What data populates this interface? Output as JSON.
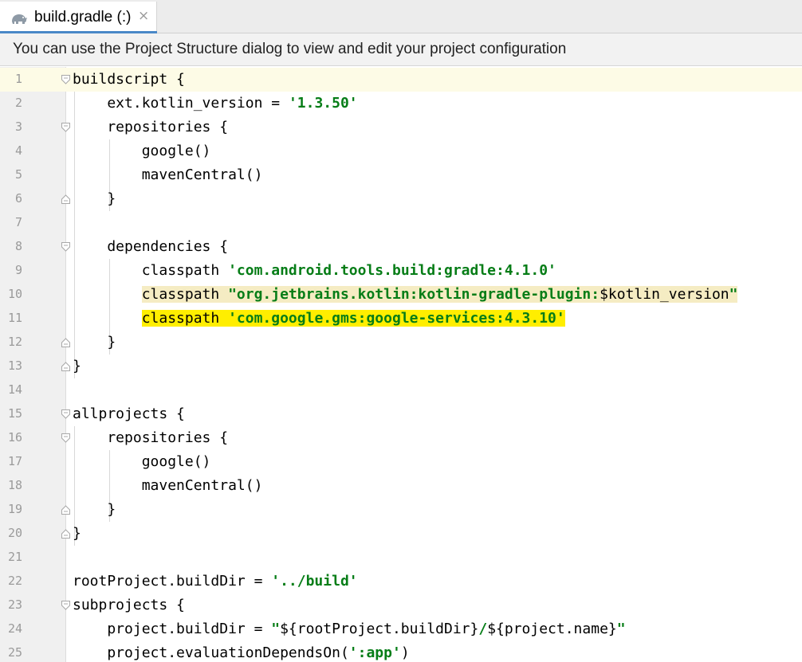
{
  "tab": {
    "label": "build.gradle (:)",
    "close_symbol": "×",
    "icon": "gradle-elephant-icon"
  },
  "banner": {
    "text": "You can use the Project Structure dialog to view and edit your project configuration"
  },
  "editor": {
    "lines": [
      {
        "n": "1",
        "fold": "open",
        "segments": [
          {
            "t": "buildscript {",
            "c": "kw"
          }
        ]
      },
      {
        "n": "2",
        "fold": "",
        "segments": [
          {
            "t": "    ext.kotlin_version = ",
            "c": "kw"
          },
          {
            "t": "'1.3.50'",
            "c": "str"
          }
        ]
      },
      {
        "n": "3",
        "fold": "open",
        "segments": [
          {
            "t": "    repositories {",
            "c": "kw"
          }
        ]
      },
      {
        "n": "4",
        "fold": "",
        "segments": [
          {
            "t": "        google()",
            "c": "kw"
          }
        ]
      },
      {
        "n": "5",
        "fold": "",
        "segments": [
          {
            "t": "        mavenCentral()",
            "c": "kw"
          }
        ]
      },
      {
        "n": "6",
        "fold": "close",
        "segments": [
          {
            "t": "    }",
            "c": "kw"
          }
        ]
      },
      {
        "n": "7",
        "fold": "",
        "segments": []
      },
      {
        "n": "8",
        "fold": "open",
        "segments": [
          {
            "t": "    dependencies {",
            "c": "kw"
          }
        ]
      },
      {
        "n": "9",
        "fold": "",
        "segments": [
          {
            "t": "        classpath ",
            "c": "kw"
          },
          {
            "t": "'com.android.tools.build:gradle:4.1.0'",
            "c": "str"
          }
        ]
      },
      {
        "n": "10",
        "fold": "",
        "hl": "light",
        "segments": [
          {
            "t": "        ",
            "c": "kw",
            "nohl": true
          },
          {
            "t": "classpath ",
            "c": "kw"
          },
          {
            "t": "\"org.jetbrains.kotlin:kotlin-gradle-plugin:",
            "c": "str-dq"
          },
          {
            "t": "$kotlin_version",
            "c": "var"
          },
          {
            "t": "\"",
            "c": "str-dq"
          }
        ]
      },
      {
        "n": "11",
        "fold": "",
        "hl": "strong",
        "segments": [
          {
            "t": "        ",
            "c": "kw",
            "nohl": true
          },
          {
            "t": "classpath ",
            "c": "kw"
          },
          {
            "t": "'com.google.gms:google-services:4.3.10'",
            "c": "str"
          }
        ]
      },
      {
        "n": "12",
        "fold": "close",
        "segments": [
          {
            "t": "    }",
            "c": "kw"
          }
        ]
      },
      {
        "n": "13",
        "fold": "close",
        "segments": [
          {
            "t": "}",
            "c": "kw"
          }
        ]
      },
      {
        "n": "14",
        "fold": "",
        "segments": []
      },
      {
        "n": "15",
        "fold": "open",
        "segments": [
          {
            "t": "allprojects {",
            "c": "kw"
          }
        ]
      },
      {
        "n": "16",
        "fold": "open",
        "segments": [
          {
            "t": "    repositories {",
            "c": "kw"
          }
        ]
      },
      {
        "n": "17",
        "fold": "",
        "segments": [
          {
            "t": "        google()",
            "c": "kw"
          }
        ]
      },
      {
        "n": "18",
        "fold": "",
        "segments": [
          {
            "t": "        mavenCentral()",
            "c": "kw"
          }
        ]
      },
      {
        "n": "19",
        "fold": "close",
        "segments": [
          {
            "t": "    }",
            "c": "kw"
          }
        ]
      },
      {
        "n": "20",
        "fold": "close",
        "segments": [
          {
            "t": "}",
            "c": "kw"
          }
        ]
      },
      {
        "n": "21",
        "fold": "",
        "segments": []
      },
      {
        "n": "22",
        "fold": "",
        "segments": [
          {
            "t": "rootProject.buildDir = ",
            "c": "kw"
          },
          {
            "t": "'../build'",
            "c": "str"
          }
        ]
      },
      {
        "n": "23",
        "fold": "open",
        "segments": [
          {
            "t": "subprojects {",
            "c": "kw"
          }
        ]
      },
      {
        "n": "24",
        "fold": "",
        "segments": [
          {
            "t": "    project.buildDir = ",
            "c": "kw"
          },
          {
            "t": "\"",
            "c": "str-dq"
          },
          {
            "t": "${rootProject.buildDir}",
            "c": "var"
          },
          {
            "t": "/",
            "c": "str-dq"
          },
          {
            "t": "${project.name}",
            "c": "var"
          },
          {
            "t": "\"",
            "c": "str-dq"
          }
        ]
      },
      {
        "n": "25",
        "fold": "",
        "segments": [
          {
            "t": "    project.evaluationDependsOn(",
            "c": "kw"
          },
          {
            "t": "':app'",
            "c": "str"
          },
          {
            "t": ")",
            "c": "kw"
          }
        ]
      }
    ]
  }
}
